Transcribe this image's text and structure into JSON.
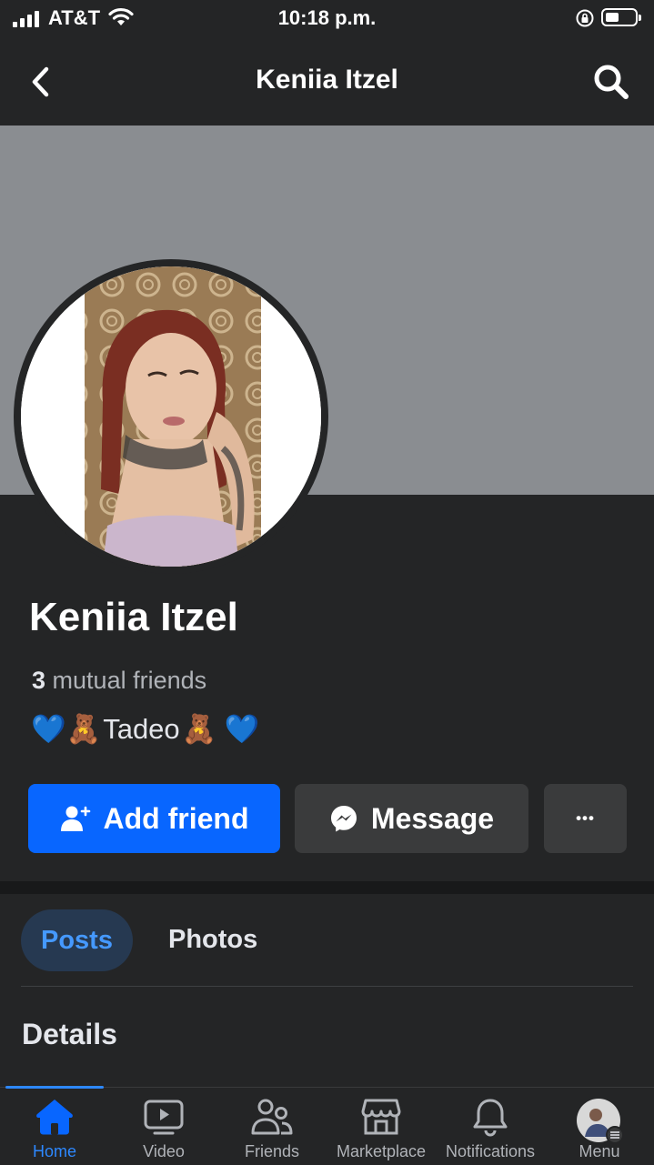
{
  "status_bar": {
    "carrier": "AT&T",
    "time": "10:18 p.m.",
    "battery_level": 0.45
  },
  "header": {
    "title": "Keniia Itzel"
  },
  "profile": {
    "name": "Keniia Itzel",
    "mutual_count": "3",
    "mutual_label": "mutual friends",
    "bio_emoji_left": "💙🧸",
    "bio_name": "Tadeo",
    "bio_emoji_right": "🧸 💙"
  },
  "actions": {
    "add_friend": "Add friend",
    "message": "Message",
    "more": "•••"
  },
  "profile_tabs": {
    "posts": "Posts",
    "photos": "Photos",
    "details_heading": "Details"
  },
  "bottom_nav": {
    "items": [
      {
        "label": "Home",
        "icon": "home-icon",
        "active": true
      },
      {
        "label": "Video",
        "icon": "video-icon"
      },
      {
        "label": "Friends",
        "icon": "friends-icon"
      },
      {
        "label": "Marketplace",
        "icon": "marketplace-icon"
      },
      {
        "label": "Notifications",
        "icon": "bell-icon"
      },
      {
        "label": "Menu",
        "icon": "menu-avatar"
      }
    ]
  },
  "colors": {
    "accent": "#0866ff",
    "background": "#242526",
    "cover": "#8a8d91",
    "active_tab": "#2d88ff"
  }
}
